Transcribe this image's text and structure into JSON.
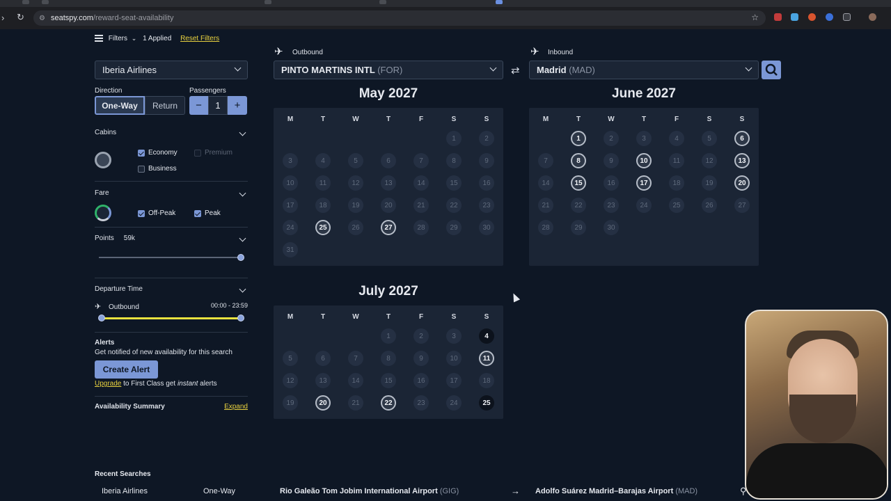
{
  "browser": {
    "url_host": "seatspy.com",
    "url_path": "/reward-seat-availability"
  },
  "filters": {
    "label": "Filters",
    "applied": "1 Applied",
    "reset": "Reset Filters"
  },
  "airline": {
    "selected": "Iberia Airlines"
  },
  "direction": {
    "label": "Direction",
    "one_way": "One-Way",
    "return": "Return",
    "selected": "One-Way"
  },
  "passengers": {
    "label": "Passengers",
    "value": "1",
    "minus": "−",
    "plus": "+"
  },
  "cabins": {
    "label": "Cabins",
    "economy": "Economy",
    "premium": "Premium",
    "business": "Business",
    "economy_checked": true,
    "premium_checked": false,
    "business_checked": false
  },
  "fare": {
    "label": "Fare",
    "off_peak": "Off-Peak",
    "peak": "Peak",
    "off_peak_checked": true,
    "peak_checked": true
  },
  "points": {
    "label": "Points",
    "value": "59k",
    "level": 1.0
  },
  "departure": {
    "label": "Departure Time",
    "outbound": "Outbound",
    "range": "00:00 - 23:59",
    "start": 0.0,
    "end": 1.0
  },
  "alerts": {
    "label": "Alerts",
    "desc": "Get notified of new availability for this search",
    "button": "Create Alert",
    "upgrade_link": "Upgrade",
    "upgrade_mid": " to First Class get ",
    "upgrade_em": "instant",
    "upgrade_end": " alerts"
  },
  "availability_summary": {
    "label": "Availability Summary",
    "expand": "Expand"
  },
  "search": {
    "outbound_label": "Outbound",
    "outbound_airport": "PINTO MARTINS INTL",
    "outbound_code": "(FOR)",
    "inbound_label": "Inbound",
    "inbound_airport": "Madrid",
    "inbound_code": "(MAD)"
  },
  "weekdays": [
    "M",
    "T",
    "W",
    "T",
    "F",
    "S",
    "S"
  ],
  "calendars": [
    {
      "title": "May 2027",
      "first_weekday": 5,
      "days": 31,
      "available": [
        25,
        27
      ],
      "dark": []
    },
    {
      "title": "June 2027",
      "first_weekday": 1,
      "days": 30,
      "available": [
        1,
        6,
        8,
        10,
        13,
        15,
        17,
        20
      ],
      "dark": []
    },
    {
      "title": "July 2027",
      "first_weekday": 3,
      "days": 25,
      "available": [
        11,
        20,
        22
      ],
      "dark": [
        4,
        25
      ]
    }
  ],
  "recent": {
    "label": "Recent Searches",
    "airline": "Iberia Airlines",
    "type": "One-Way",
    "from": "Rio Galeão Tom Jobim International Airport",
    "from_code": "(GIG)",
    "to": "Adolfo Suárez Madrid–Barajas Airport",
    "to_code": "(MAD)"
  },
  "colors": {
    "accent": "#7b97d6",
    "slider_fill": "#e9e23f",
    "link": "#e9d23f",
    "background": "#0e1725",
    "panel": "#1b2535"
  }
}
